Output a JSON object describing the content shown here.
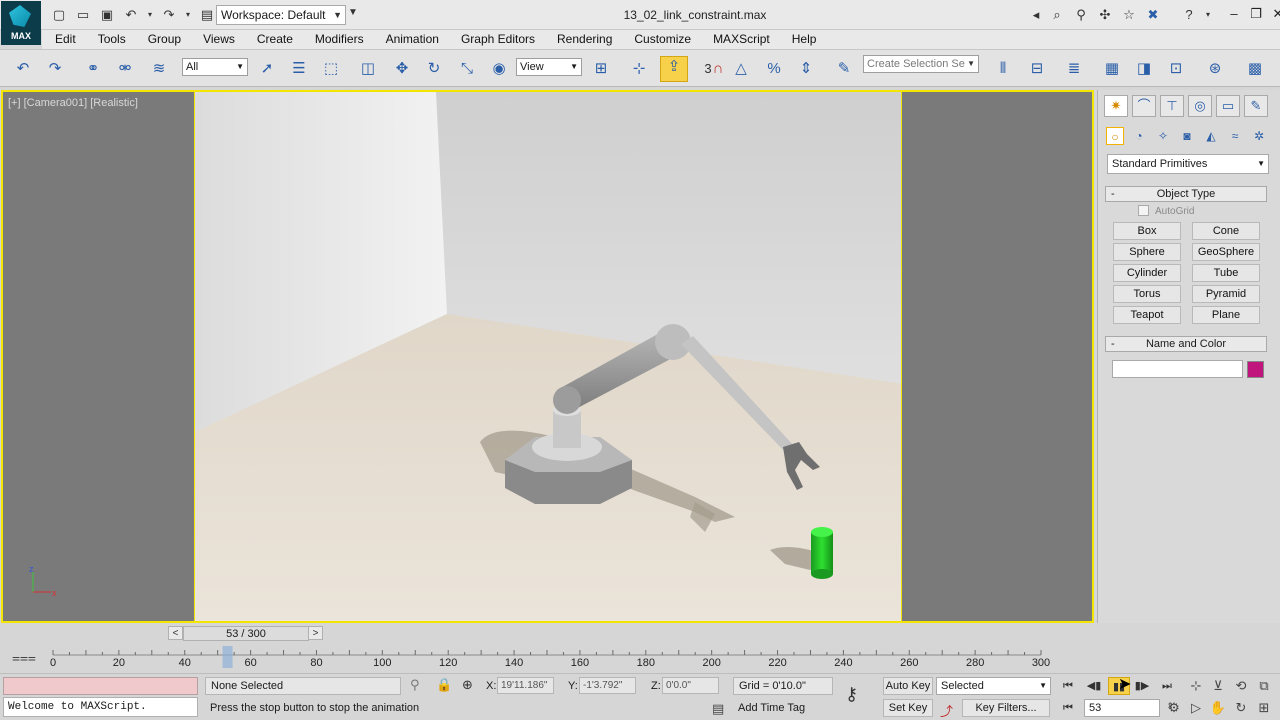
{
  "app": {
    "logo_text": "MAX",
    "workspace": "Workspace: Default",
    "file_title": "13_02_link_constraint.max"
  },
  "menu": [
    "Edit",
    "Tools",
    "Group",
    "Views",
    "Create",
    "Modifiers",
    "Animation",
    "Graph Editors",
    "Rendering",
    "Customize",
    "MAXScript",
    "Help"
  ],
  "toolbar": {
    "selection_filter": "All",
    "ref_coord": "View",
    "snap_value": "3",
    "selection_set_placeholder": "Create Selection Se"
  },
  "viewport": {
    "label": "[+] [Camera001] [Realistic]",
    "axis_z": "z",
    "axis_x": "x"
  },
  "command_panel": {
    "category": "Standard Primitives",
    "object_type_title": "Object Type",
    "autogrid_label": "AutoGrid",
    "objects": [
      "Box",
      "Cone",
      "Sphere",
      "GeoSphere",
      "Cylinder",
      "Tube",
      "Torus",
      "Pyramid",
      "Teapot",
      "Plane"
    ],
    "name_color_title": "Name and Color",
    "object_color": "#c0157d"
  },
  "time_slider": {
    "current_frame": 53,
    "total_frames": 300,
    "label": "53 / 300",
    "prev": "<",
    "next": ">"
  },
  "track": {
    "ticks": [
      "0",
      "20",
      "40",
      "60",
      "80",
      "100",
      "120",
      "140",
      "160",
      "180",
      "200",
      "220",
      "240",
      "260",
      "280",
      "300"
    ]
  },
  "status": {
    "maxscript_output": "Welcome to MAXScript.",
    "selection": "None Selected",
    "prompt": "Press the stop button to stop the animation",
    "x_label": "X:",
    "x_value": "19'11.186\"",
    "y_label": "Y:",
    "y_value": "-1'3.792\"",
    "z_label": "Z:",
    "z_value": "0'0.0\"",
    "grid": "Grid = 0'10.0\"",
    "add_time_tag": "Add Time Tag",
    "auto_key": "Auto Key",
    "set_key": "Set Key",
    "key_set": "Selected",
    "key_filters": "Key Filters...",
    "frame_field": "53"
  },
  "colors": {
    "viewport_border": "#f2e600",
    "play_active": "#f7d14a",
    "cylinder": "#22c22a"
  }
}
